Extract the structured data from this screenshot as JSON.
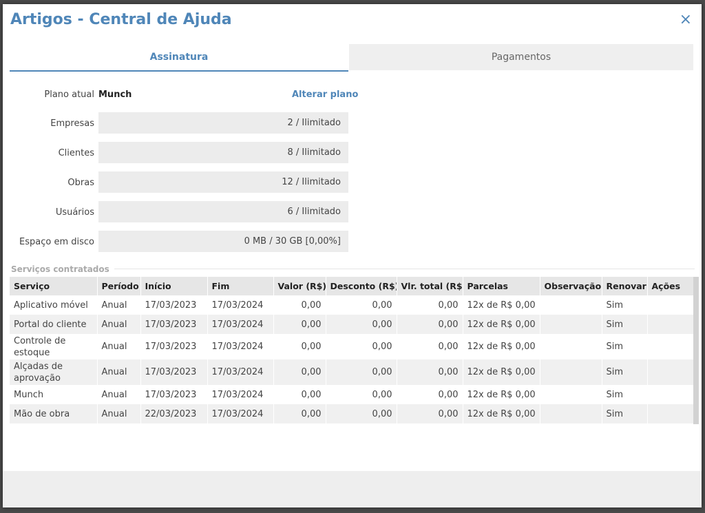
{
  "modal": {
    "title": "Artigos - Central de Ajuda",
    "close_icon": "×"
  },
  "tabs": [
    {
      "label": "Assinatura",
      "active": true
    },
    {
      "label": "Pagamentos",
      "active": false
    }
  ],
  "plan": {
    "label": "Plano atual",
    "name": "Munch",
    "change_label": "Alterar plano"
  },
  "quotas": [
    {
      "label": "Empresas",
      "value": "2 / Ilimitado"
    },
    {
      "label": "Clientes",
      "value": "8 / Ilimitado"
    },
    {
      "label": "Obras",
      "value": "12 / Ilimitado"
    },
    {
      "label": "Usuários",
      "value": "6 / Ilimitado"
    },
    {
      "label": "Espaço em disco",
      "value": "0 MB / 30 GB [0,00%]"
    }
  ],
  "services": {
    "section_title": "Serviços contratados",
    "columns": [
      "Serviço",
      "Período",
      "Início",
      "Fim",
      "Valor (R$)",
      "Desconto (R$)",
      "Vlr. total (R$)",
      "Parcelas",
      "Observação",
      "Renovar",
      "Ações"
    ],
    "rows": [
      {
        "servico": "Aplicativo móvel",
        "periodo": "Anual",
        "inicio": "17/03/2023",
        "fim": "17/03/2024",
        "valor": "0,00",
        "desconto": "0,00",
        "total": "0,00",
        "parcelas": "12x de R$ 0,00",
        "observacao": "",
        "renovar": "Sim",
        "acoes": ""
      },
      {
        "servico": "Portal do cliente",
        "periodo": "Anual",
        "inicio": "17/03/2023",
        "fim": "17/03/2024",
        "valor": "0,00",
        "desconto": "0,00",
        "total": "0,00",
        "parcelas": "12x de R$ 0,00",
        "observacao": "",
        "renovar": "Sim",
        "acoes": ""
      },
      {
        "servico": "Controle de estoque",
        "periodo": "Anual",
        "inicio": "17/03/2023",
        "fim": "17/03/2024",
        "valor": "0,00",
        "desconto": "0,00",
        "total": "0,00",
        "parcelas": "12x de R$ 0,00",
        "observacao": "",
        "renovar": "Sim",
        "acoes": ""
      },
      {
        "servico": "Alçadas de aprovação",
        "periodo": "Anual",
        "inicio": "17/03/2023",
        "fim": "17/03/2024",
        "valor": "0,00",
        "desconto": "0,00",
        "total": "0,00",
        "parcelas": "12x de R$ 0,00",
        "observacao": "",
        "renovar": "Sim",
        "acoes": ""
      },
      {
        "servico": "Munch",
        "periodo": "Anual",
        "inicio": "17/03/2023",
        "fim": "17/03/2024",
        "valor": "0,00",
        "desconto": "0,00",
        "total": "0,00",
        "parcelas": "12x de R$ 0,00",
        "observacao": "",
        "renovar": "Sim",
        "acoes": ""
      },
      {
        "servico": "Mão de obra",
        "periodo": "Anual",
        "inicio": "22/03/2023",
        "fim": "17/03/2024",
        "valor": "0,00",
        "desconto": "0,00",
        "total": "0,00",
        "parcelas": "12x de R$ 0,00",
        "observacao": "",
        "renovar": "Sim",
        "acoes": ""
      }
    ]
  }
}
